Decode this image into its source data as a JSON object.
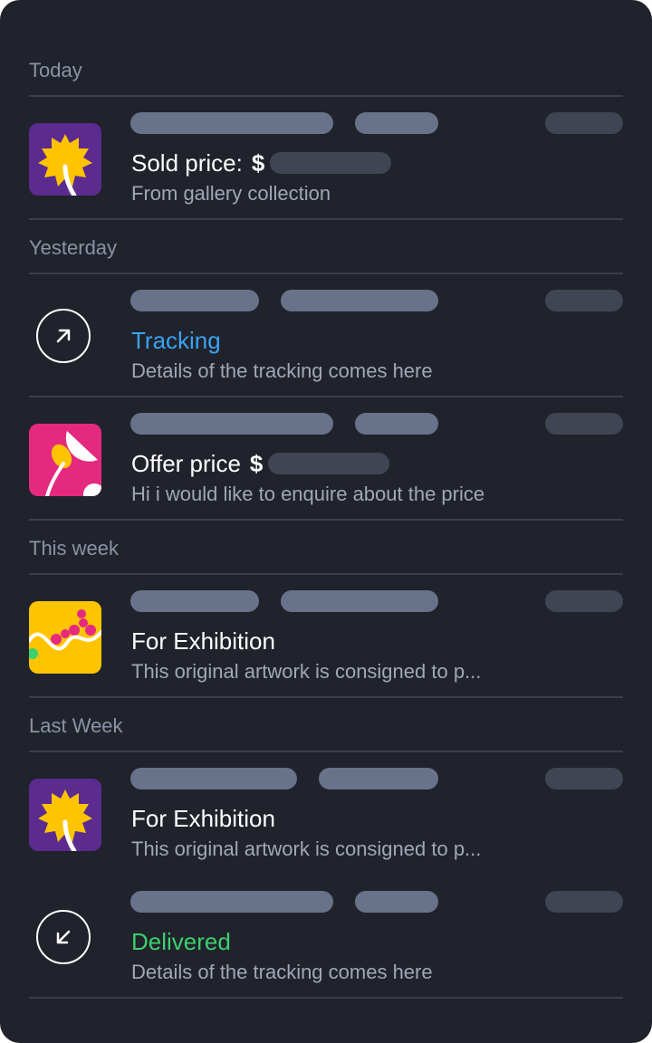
{
  "sections": {
    "today": "Today",
    "yesterday": "Yesterday",
    "this_week": "This week",
    "last_week": "Last Week"
  },
  "items": [
    {
      "icon": "sunflower-art-icon",
      "title": "Sold price:",
      "currency": "$",
      "subtitle": "From gallery collection",
      "icon_bg": "#5b2b8f"
    },
    {
      "icon": "arrow-up-right-icon",
      "title": "Tracking",
      "subtitle": "Details of the tracking comes here",
      "title_color": "#3aa3f2"
    },
    {
      "icon": "pink-flower-art-icon",
      "title": "Offer price",
      "currency": "$",
      "subtitle": "Hi i would like to enquire about the price",
      "icon_bg": "#e5297f"
    },
    {
      "icon": "yellow-abstract-art-icon",
      "title": "For Exhibition",
      "subtitle": "This original artwork is consigned to p...",
      "icon_bg": "#ffc400"
    },
    {
      "icon": "sunflower-art-icon",
      "title": "For Exhibition",
      "subtitle": "This original artwork is consigned to p...",
      "icon_bg": "#5b2b8f"
    },
    {
      "icon": "arrow-down-left-icon",
      "title": "Delivered",
      "subtitle": "Details of the tracking comes here",
      "title_color": "#3ccf6e"
    }
  ],
  "colors": {
    "background": "#20232b",
    "placeholder_light": "#68728a",
    "placeholder_dark": "#3f4553",
    "divider": "#3a3f4c"
  }
}
